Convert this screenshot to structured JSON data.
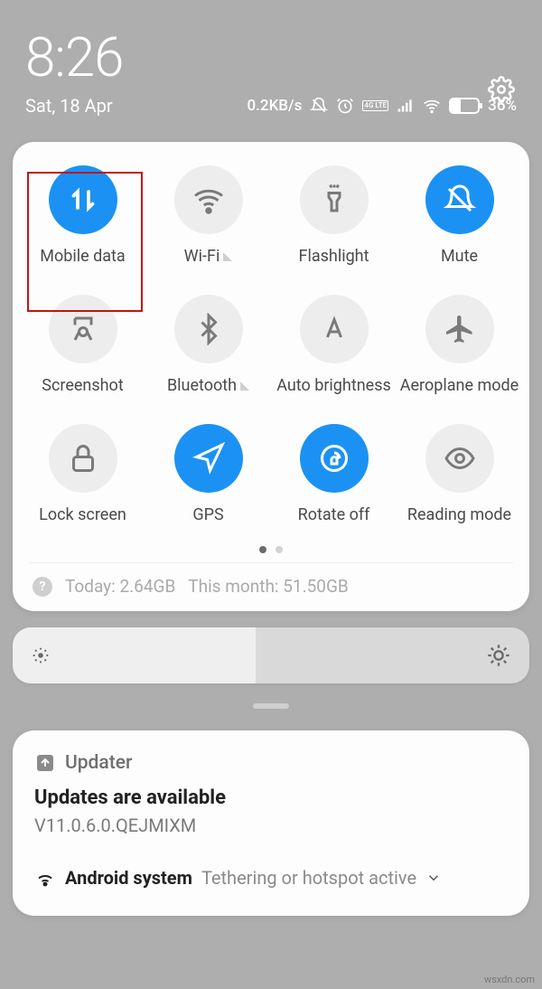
{
  "status": {
    "time": "8:26",
    "date": "Sat, 18 Apr",
    "net_speed": "0.2KB/s",
    "lte_label": "4G LTE",
    "battery_pct": "36%"
  },
  "toggles": [
    {
      "id": "mobile-data",
      "label": "Mobile data",
      "active": true,
      "caret": false
    },
    {
      "id": "wifi",
      "label": "Wi-Fi",
      "active": false,
      "caret": true
    },
    {
      "id": "flashlight",
      "label": "Flashlight",
      "active": false,
      "caret": false
    },
    {
      "id": "mute",
      "label": "Mute",
      "active": true,
      "caret": false
    },
    {
      "id": "screenshot",
      "label": "Screenshot",
      "active": false,
      "caret": false
    },
    {
      "id": "bluetooth",
      "label": "Bluetooth",
      "active": false,
      "caret": true
    },
    {
      "id": "auto-brightness",
      "label": "Auto brightness",
      "active": false,
      "caret": false
    },
    {
      "id": "aeroplane",
      "label": "Aeroplane mode",
      "active": false,
      "caret": false
    },
    {
      "id": "lock-screen",
      "label": "Lock screen",
      "active": false,
      "caret": false
    },
    {
      "id": "gps",
      "label": "GPS",
      "active": true,
      "caret": false
    },
    {
      "id": "rotate-off",
      "label": "Rotate off",
      "active": true,
      "caret": false
    },
    {
      "id": "reading-mode",
      "label": "Reading mode",
      "active": false,
      "caret": false
    }
  ],
  "usage": {
    "today": "Today: 2.64GB",
    "month": "This month: 51.50GB"
  },
  "notification": {
    "app": "Updater",
    "title": "Updates are available",
    "body": "V11.0.6.0.QEJMIXM",
    "system_app": "Android system",
    "system_msg": "Tethering or hotspot active"
  },
  "watermark": "wsxdn.com"
}
